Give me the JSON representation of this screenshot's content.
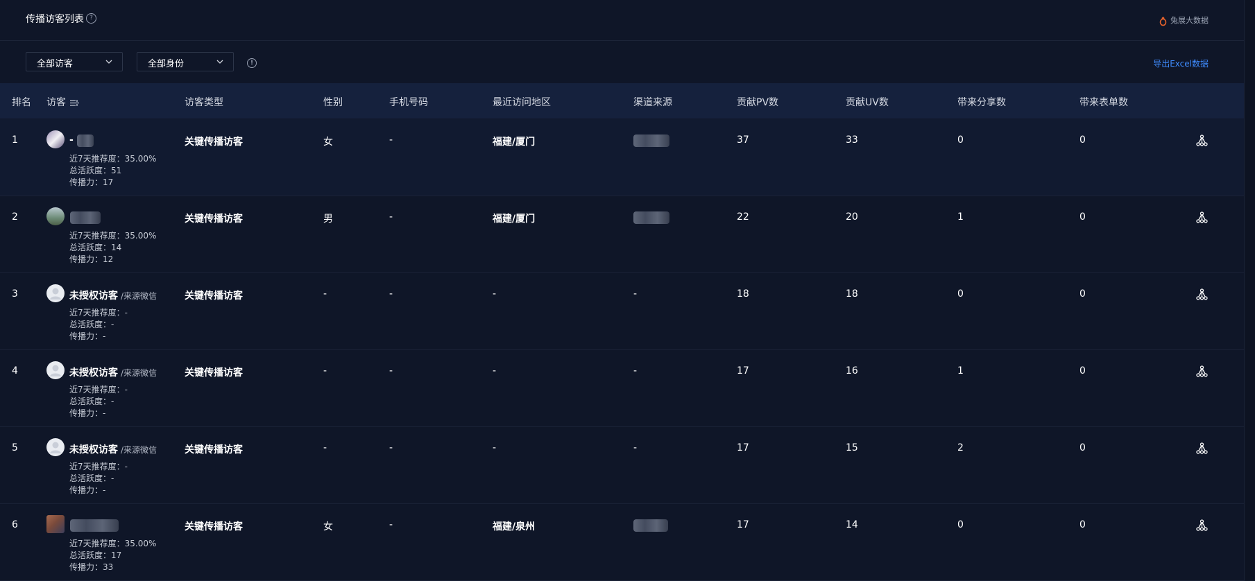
{
  "header": {
    "title": "传播访客列表",
    "brand": "兔展大数据"
  },
  "filters": {
    "visitor_select": "全部访客",
    "identity_select": "全部身份",
    "export_label": "导出Excel数据"
  },
  "columns": {
    "rank": "排名",
    "visitor": "访客",
    "type": "访客类型",
    "sex": "性别",
    "phone": "手机号码",
    "region": "最近访问地区",
    "channel": "渠道来源",
    "pv": "贡献PV数",
    "uv": "贡献UV数",
    "share": "带来分享数",
    "form": "带来表单数"
  },
  "rows": [
    {
      "rank": "1",
      "name": "-",
      "source": "",
      "rec": "近7天推荐度：35.00%",
      "act": "总活跃度：51",
      "spread": "传播力：17",
      "type": "关键传播访客",
      "sex": "女",
      "phone": "-",
      "region": "福建/厦门",
      "channel": "",
      "pv": "37",
      "uv": "33",
      "share": "0",
      "form": "0"
    },
    {
      "rank": "2",
      "name": "",
      "source": "",
      "rec": "近7天推荐度：35.00%",
      "act": "总活跃度：14",
      "spread": "传播力：12",
      "type": "关键传播访客",
      "sex": "男",
      "phone": "-",
      "region": "福建/厦门",
      "channel": "",
      "pv": "22",
      "uv": "20",
      "share": "1",
      "form": "0"
    },
    {
      "rank": "3",
      "name": "未授权访客",
      "source": "/来源微信",
      "rec": "近7天推荐度：-",
      "act": "总活跃度：-",
      "spread": "传播力：-",
      "type": "关键传播访客",
      "sex": "-",
      "phone": "-",
      "region": "-",
      "channel": "-",
      "pv": "18",
      "uv": "18",
      "share": "0",
      "form": "0"
    },
    {
      "rank": "4",
      "name": "未授权访客",
      "source": "/来源微信",
      "rec": "近7天推荐度：-",
      "act": "总活跃度：-",
      "spread": "传播力：-",
      "type": "关键传播访客",
      "sex": "-",
      "phone": "-",
      "region": "-",
      "channel": "-",
      "pv": "17",
      "uv": "16",
      "share": "1",
      "form": "0"
    },
    {
      "rank": "5",
      "name": "未授权访客",
      "source": "/来源微信",
      "rec": "近7天推荐度：-",
      "act": "总活跃度：-",
      "spread": "传播力：-",
      "type": "关键传播访客",
      "sex": "-",
      "phone": "-",
      "region": "-",
      "channel": "-",
      "pv": "17",
      "uv": "15",
      "share": "2",
      "form": "0"
    },
    {
      "rank": "6",
      "name": "",
      "source": "",
      "rec": "近7天推荐度：35.00%",
      "act": "总活跃度：17",
      "spread": "传播力：33",
      "type": "关键传播访客",
      "sex": "女",
      "phone": "-",
      "region": "福建/泉州",
      "channel": "",
      "pv": "17",
      "uv": "14",
      "share": "0",
      "form": "0"
    }
  ]
}
